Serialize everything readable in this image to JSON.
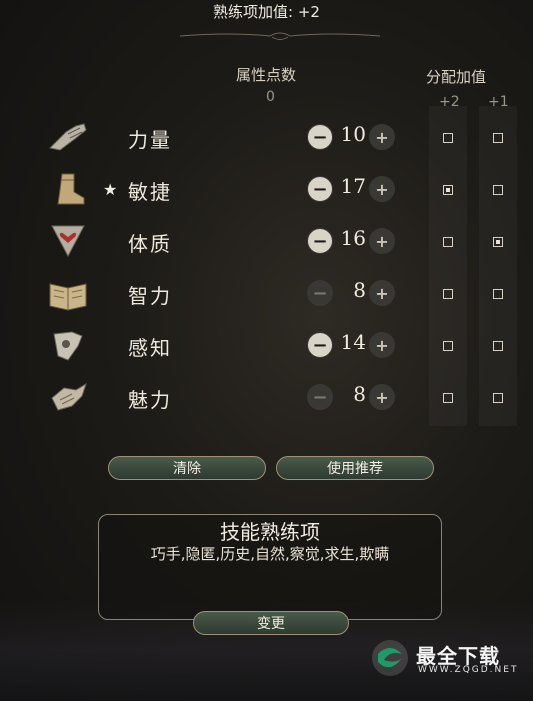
{
  "header": {
    "title": "熟练项加值: +2"
  },
  "columns": {
    "points_label": "属性点数",
    "points_remaining": "0",
    "bonus_label": "分配加值",
    "plus2_label": "+2",
    "plus1_label": "+1"
  },
  "abilities": [
    {
      "name": "力量",
      "icon": "gauntlet-icon",
      "value": "10",
      "starred": false,
      "minus": "−",
      "plus": "+",
      "plus2_checked": false,
      "plus1_checked": false
    },
    {
      "name": "敏捷",
      "icon": "boot-icon",
      "value": "17",
      "starred": true,
      "minus": "−",
      "plus": "+",
      "plus2_checked": true,
      "plus1_checked": false
    },
    {
      "name": "体质",
      "icon": "heart-shield-icon",
      "value": "16",
      "starred": false,
      "minus": "−",
      "plus": "+",
      "plus2_checked": false,
      "plus1_checked": true
    },
    {
      "name": "智力",
      "icon": "open-book-icon",
      "value": "8",
      "starred": false,
      "minus": "−",
      "plus": "+",
      "plus2_checked": false,
      "plus1_checked": false
    },
    {
      "name": "感知",
      "icon": "hand-icon",
      "value": "14",
      "starred": false,
      "minus": "−",
      "plus": "+",
      "plus2_checked": false,
      "plus1_checked": false
    },
    {
      "name": "魅力",
      "icon": "claw-icon",
      "value": "8",
      "starred": false,
      "minus": "−",
      "plus": "+",
      "plus2_checked": false,
      "plus1_checked": false
    }
  ],
  "star_symbol": "★",
  "buttons": {
    "clear": "清除",
    "recommend": "使用推荐",
    "change": "变更"
  },
  "skills": {
    "title": "技能熟练项",
    "list": "巧手,隐匿,历史,自然,察觉,求生,欺瞒"
  },
  "watermark": {
    "text": "最全下载",
    "url": "WWW.ZQGD.NET"
  },
  "colors": {
    "button_green": "#3b4a3d",
    "gold_border": "#9b9279"
  }
}
